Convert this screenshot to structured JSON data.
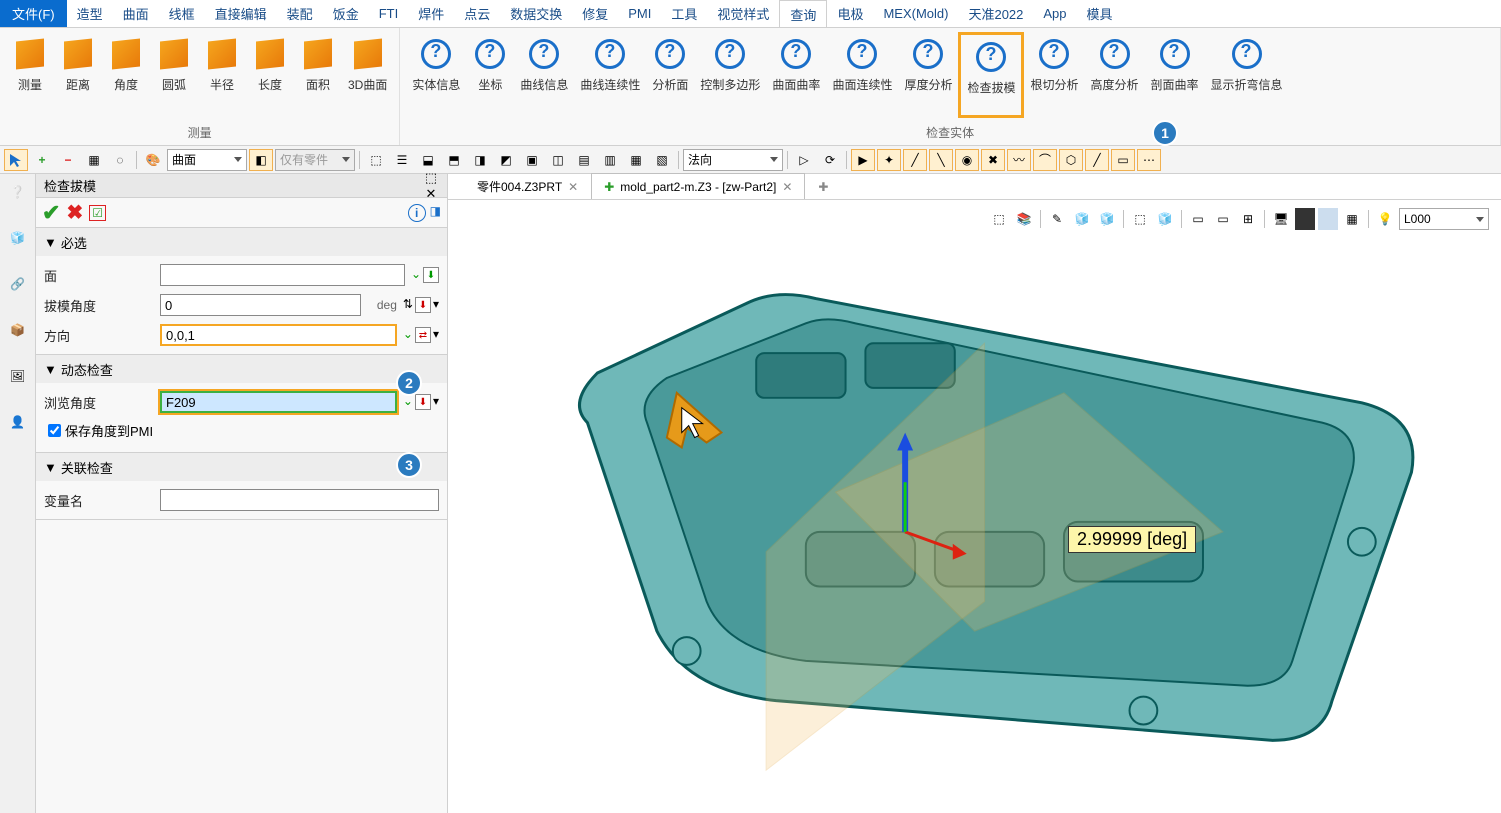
{
  "menu": {
    "file": "文件(F)",
    "items": [
      "造型",
      "曲面",
      "线框",
      "直接编辑",
      "装配",
      "饭金",
      "FTI",
      "焊件",
      "点云",
      "数据交换",
      "修复",
      "PMI",
      "工具",
      "视觉样式",
      "查询",
      "电极",
      "MEX(Mold)",
      "天准2022",
      "App",
      "模具"
    ],
    "active_index": 14
  },
  "ribbon": {
    "group1_label": "测量",
    "group1": [
      "测量",
      "距离",
      "角度",
      "圆弧",
      "半径",
      "长度",
      "面积",
      "3D曲面"
    ],
    "group2_label": "检查实体",
    "group2": [
      "实体信息",
      "坐标",
      "曲线信息",
      "曲线连续性",
      "分析面",
      "控制多边形",
      "曲面曲率",
      "曲面连续性",
      "厚度分析",
      "检查拔模",
      "根切分析",
      "高度分析",
      "剖面曲率",
      "显示折弯信息"
    ],
    "highlight_index": 9
  },
  "toolbar": {
    "combo1": "曲面",
    "combo2": "仅有零件",
    "combo3": "法向",
    "combo4": "L000"
  },
  "panel": {
    "title": "检查拔模",
    "sections": {
      "required": "必选",
      "dynamic": "动态检查",
      "linked": "关联检查"
    },
    "fields": {
      "face": "面",
      "draft_angle": "拔模角度",
      "draft_angle_val": "0",
      "draft_angle_unit": "deg",
      "direction": "方向",
      "direction_val": "0,0,1",
      "browse_angle": "浏览角度",
      "browse_angle_val": "F209",
      "save_to_pmi": "保存角度到PMI",
      "varname": "变量名"
    }
  },
  "tabs": {
    "tab1": "零件004.Z3PRT",
    "tab2": "mold_part2-m.Z3 - [zw-Part2]"
  },
  "viewport": {
    "tooltip": "2.99999  [deg]"
  },
  "badges": {
    "b1": "1",
    "b2": "2",
    "b3": "3"
  }
}
